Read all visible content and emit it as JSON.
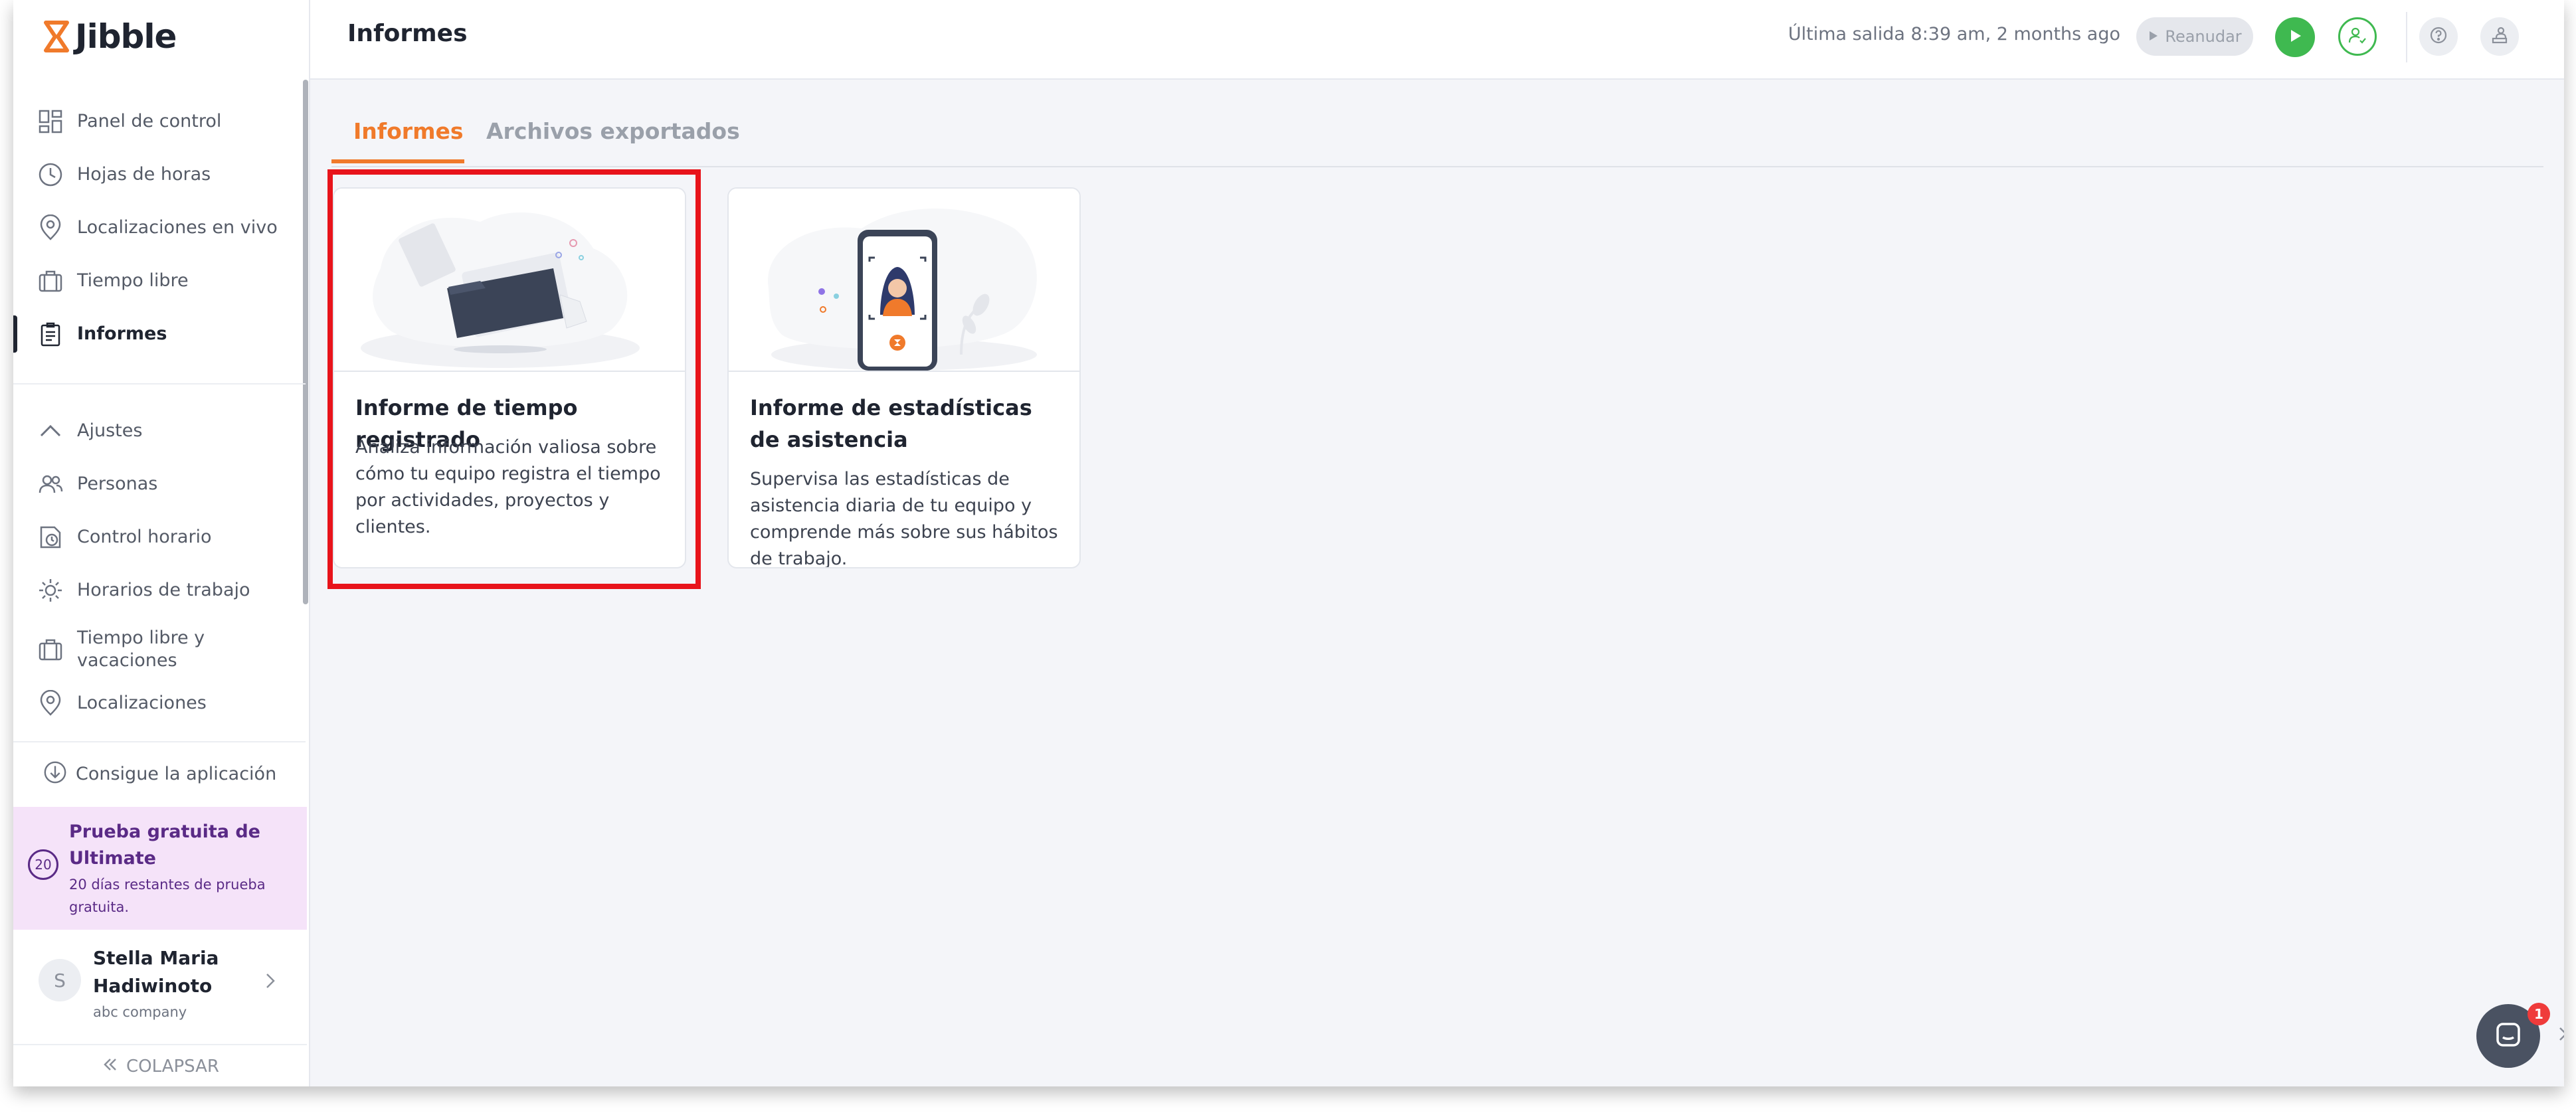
{
  "app": {
    "name": "Jibble",
    "accent": "#f07a2b"
  },
  "sidebar": {
    "items": [
      {
        "label": "Panel de control",
        "icon": "dashboard-icon"
      },
      {
        "label": "Hojas de horas",
        "icon": "clock-icon"
      },
      {
        "label": "Localizaciones en vivo",
        "icon": "location-pin-icon"
      },
      {
        "label": "Tiempo libre",
        "icon": "suitcase-icon"
      },
      {
        "label": "Informes",
        "icon": "report-icon",
        "active": true
      }
    ],
    "settings": [
      {
        "label": "Ajustes",
        "icon": "chevron-up-icon"
      },
      {
        "label": "Personas",
        "icon": "people-icon"
      },
      {
        "label": "Control horario",
        "icon": "time-tracking-icon"
      },
      {
        "label": "Horarios de trabajo",
        "icon": "sun-icon"
      },
      {
        "label": "Tiempo libre y vacaciones",
        "icon": "suitcase-icon"
      },
      {
        "label": "Localizaciones",
        "icon": "location-pin-icon"
      }
    ],
    "get_app": "Consigue la aplicación",
    "promo": {
      "badge": "20",
      "title": "Prueba gratuita de Ultimate",
      "subtitle": "20 días restantes de prueba gratuita."
    },
    "user": {
      "initial": "S",
      "name": "Stella Maria Hadiwinoto",
      "company": "abc company"
    },
    "collapse": "COLAPSAR"
  },
  "header": {
    "title": "Informes",
    "last_out": "Última salida 8:39 am, 2 months ago",
    "resume": "Reanudar"
  },
  "tabs": [
    {
      "label": "Informes",
      "active": true
    },
    {
      "label": "Archivos exportados",
      "active": false
    }
  ],
  "cards": [
    {
      "title": "Informe de tiempo registrado",
      "description": "Analiza información valiosa sobre cómo tu equipo registra el tiempo por actividades, proyectos y clientes."
    },
    {
      "title": "Informe de estadísticas de asistencia",
      "description": "Supervisa las estadísticas de asistencia diaria de tu equipo y comprende más sobre sus hábitos de trabajo."
    }
  ],
  "chat": {
    "badge": "1"
  }
}
